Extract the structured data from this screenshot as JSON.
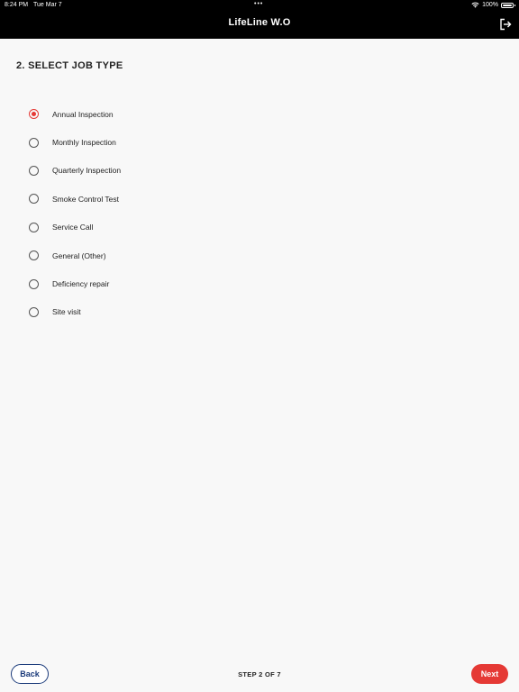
{
  "status_bar": {
    "time": "8:24 PM",
    "date": "Tue Mar 7",
    "dots": "•••",
    "battery": "100%"
  },
  "header": {
    "title": "LifeLine W.O"
  },
  "section": {
    "title": "2. SELECT JOB TYPE"
  },
  "job_types": [
    {
      "label": "Annual Inspection",
      "selected": true
    },
    {
      "label": "Monthly Inspection",
      "selected": false
    },
    {
      "label": "Quarterly Inspection",
      "selected": false
    },
    {
      "label": "Smoke Control Test",
      "selected": false
    },
    {
      "label": "Service Call",
      "selected": false
    },
    {
      "label": "General (Other)",
      "selected": false
    },
    {
      "label": "Deficiency repair",
      "selected": false
    },
    {
      "label": "Site visit",
      "selected": false
    }
  ],
  "footer": {
    "back_label": "Back",
    "step_text": "STEP 2 OF 7",
    "next_label": "Next"
  },
  "colors": {
    "accent": "#e53935",
    "back_border": "#1a3a7a",
    "header_bg": "#000000"
  }
}
